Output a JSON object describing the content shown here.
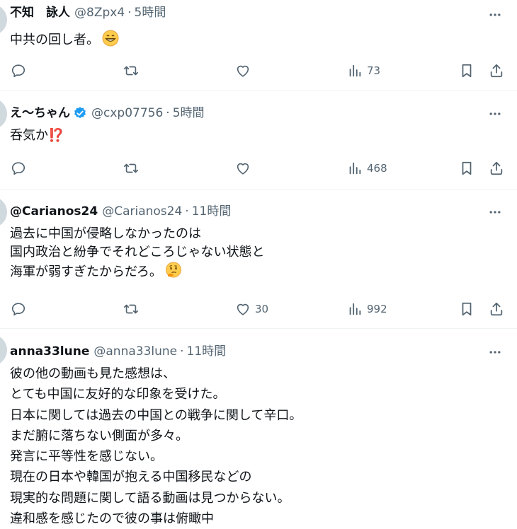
{
  "tweets": [
    {
      "name": "不知　詠人",
      "handle": "@8Zpx4",
      "sep": "·",
      "time": "5時間",
      "verified": false,
      "lines": [
        "中共の回し者。"
      ],
      "emoji": "grinning-face",
      "reply_count": "",
      "retweet_count": "",
      "like_count": "",
      "view_count": "73"
    },
    {
      "name": "え～ちゃん",
      "handle": "@cxp07756",
      "sep": "·",
      "time": "5時間",
      "verified": true,
      "lines": [
        "呑気か⁉️"
      ],
      "emoji": "",
      "reply_count": "",
      "retweet_count": "",
      "like_count": "",
      "view_count": "468"
    },
    {
      "name": "@Carianos24",
      "handle": "@Carianos24",
      "sep": "·",
      "time": "11時間",
      "verified": false,
      "lines": [
        "過去に中国が侵略しなかったのは",
        "国内政治と紛争でそれどころじゃない状態と",
        "海軍が弱すぎたからだろ。"
      ],
      "emoji": "thinking-face",
      "reply_count": "",
      "retweet_count": "",
      "like_count": "30",
      "view_count": "992"
    },
    {
      "name": "anna33lune",
      "handle": "@anna33lune",
      "sep": "·",
      "time": "11時間",
      "verified": false,
      "lines": [
        "彼の他の動画も見た感想は、",
        "とても中国に友好的な印象を受けた。",
        "日本に関しては過去の中国との戦争に関して辛口。",
        "まだ腑に落ちない側面が多々。",
        "発言に平等性を感じない。",
        "現在の日本や韓国が抱える中国移民などの",
        "現実的な問題に関して語る動画は見つからない。",
        "違和感を感じたので彼の事は俯瞰中"
      ],
      "emoji": "",
      "reply_count": "",
      "retweet_count": "",
      "like_count": "",
      "view_count": ""
    }
  ],
  "colors": {
    "text": "#0f1419",
    "muted": "#536471",
    "border": "#eff3f4",
    "verified": "#1d9bf0",
    "exclamation": "#be1931"
  },
  "icons": [
    "more-icon",
    "reply-icon",
    "retweet-icon",
    "like-icon",
    "views-icon",
    "bookmark-icon",
    "share-icon",
    "verified-badge-icon"
  ]
}
